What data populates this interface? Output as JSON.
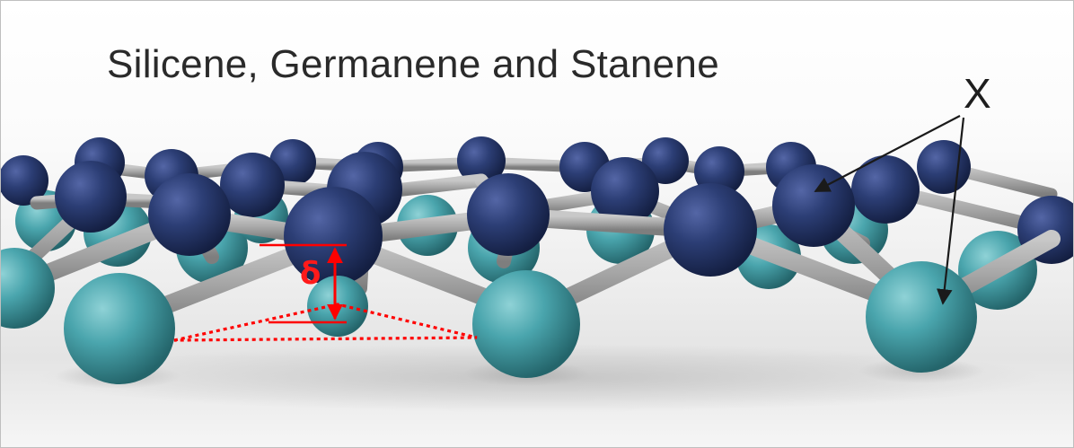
{
  "title": "Silicene, Germanene and Stanene",
  "labels": {
    "atom_label": "X",
    "buckling_label": "δ"
  },
  "colors": {
    "upper_atom": "#2c3e75",
    "lower_atom": "#4aa5ad",
    "bond": "#a9a9a9",
    "annotation": "#ff0000"
  }
}
